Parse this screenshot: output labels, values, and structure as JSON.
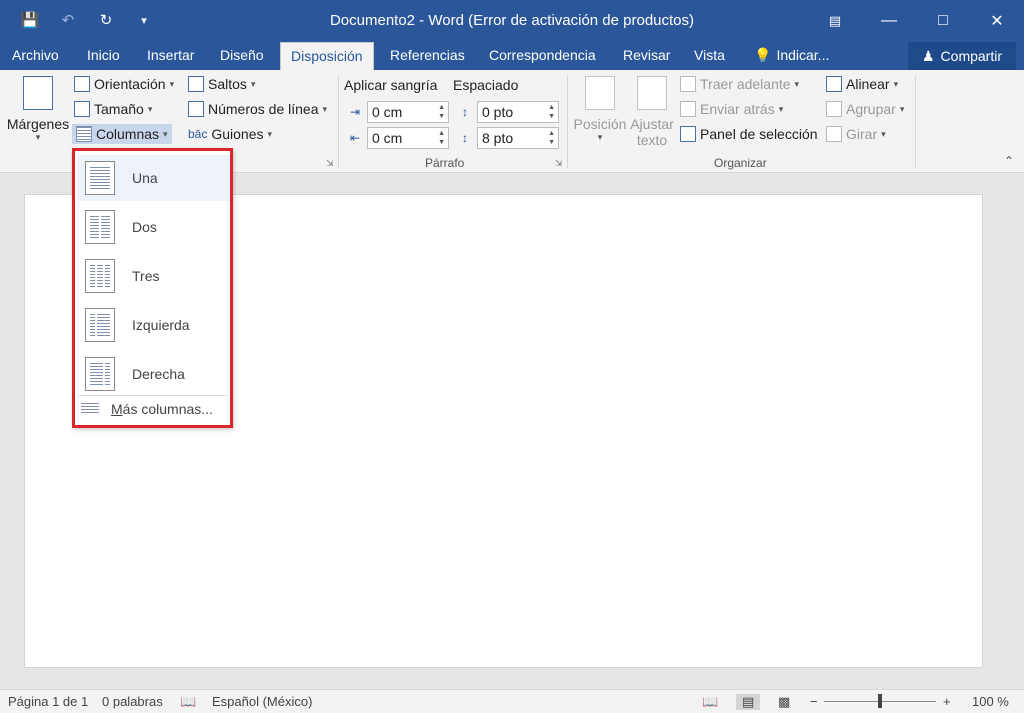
{
  "window": {
    "title": "Documento2 - Word (Error de activación de productos)",
    "qat": [
      "save-icon",
      "undo-icon",
      "redo-icon",
      "customize-qat-icon"
    ],
    "controls": [
      "ribbon-display-icon",
      "minimize-icon",
      "maximize-icon",
      "close-icon"
    ]
  },
  "tabs": [
    {
      "label": "Archivo"
    },
    {
      "label": "Inicio"
    },
    {
      "label": "Insertar"
    },
    {
      "label": "Diseño"
    },
    {
      "label": "Disposición"
    },
    {
      "label": "Referencias"
    },
    {
      "label": "Correspondencia"
    },
    {
      "label": "Revisar"
    },
    {
      "label": "Vista"
    },
    {
      "label": "Indicar..."
    }
  ],
  "active_tab": "Disposición",
  "share_label": "Compartir",
  "ribbon": {
    "page_setup": {
      "margenes": "Márgenes",
      "orientacion": "Orientación",
      "tamano": "Tamaño",
      "columnas": "Columnas",
      "saltos": "Saltos",
      "numeros_linea": "Números de línea",
      "guiones": "Guiones"
    },
    "paragraph": {
      "indent_title": "Aplicar sangría",
      "spacing_title": "Espaciado",
      "indent_left": "0 cm",
      "indent_right": "0 cm",
      "space_before": "0 pto",
      "space_after": "8 pto",
      "label": "Párrafo"
    },
    "arrange": {
      "posicion": "Posición",
      "ajustar_1": "Ajustar",
      "ajustar_2": "texto",
      "traer": "Traer adelante",
      "enviar": "Enviar atrás",
      "panel": "Panel de selección",
      "alinear": "Alinear",
      "agrupar": "Agrupar",
      "girar": "Girar",
      "label": "Organizar"
    }
  },
  "columns_menu": {
    "items": [
      {
        "label": "Una",
        "cols": 1
      },
      {
        "label": "Dos",
        "cols": 2
      },
      {
        "label": "Tres",
        "cols": 3
      },
      {
        "label": "Izquierda",
        "cols": 2
      },
      {
        "label": "Derecha",
        "cols": 2
      }
    ],
    "more_prefix": "M",
    "more_rest": "ás columnas..."
  },
  "status": {
    "page": "Página 1 de 1",
    "words": "0 palabras",
    "language": "Español (México)",
    "zoom": "100 %",
    "zoom_minus": "−",
    "zoom_plus": "+"
  },
  "colors": {
    "title_bar": "#2b579a",
    "highlight": "#d9252b"
  }
}
